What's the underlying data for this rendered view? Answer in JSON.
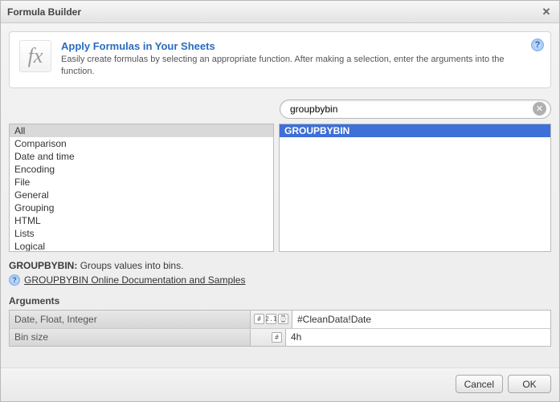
{
  "dialog": {
    "title": "Formula Builder"
  },
  "info": {
    "heading": "Apply Formulas in Your Sheets",
    "body": "Easily create formulas by selecting an appropriate function. After making a selection, enter the arguments into the function."
  },
  "search": {
    "value": "groupbybin"
  },
  "categories": {
    "items": [
      "All",
      "Comparison",
      "Date and time",
      "Encoding",
      "File",
      "General",
      "Grouping",
      "HTML",
      "Lists",
      "Logical"
    ],
    "selected_index": 0
  },
  "functions": {
    "items": [
      "GROUPBYBIN"
    ],
    "selected_index": 0
  },
  "description": {
    "name": "GROUPBYBIN",
    "text": "Groups values into bins.",
    "doc_link": "GROUPBYBIN Online Documentation and Samples"
  },
  "arguments": {
    "section_label": "Arguments",
    "rows": [
      {
        "label": "Date, Float, Integer",
        "types": [
          "#",
          "2.1",
          "⌚"
        ],
        "value": "#CleanData!Date"
      },
      {
        "label": "Bin size",
        "types": [
          "#"
        ],
        "value": "4h"
      }
    ]
  },
  "buttons": {
    "cancel": "Cancel",
    "ok": "OK"
  },
  "icons": {
    "fx": "fx",
    "help": "?",
    "close": "✕",
    "clear": "✕"
  }
}
